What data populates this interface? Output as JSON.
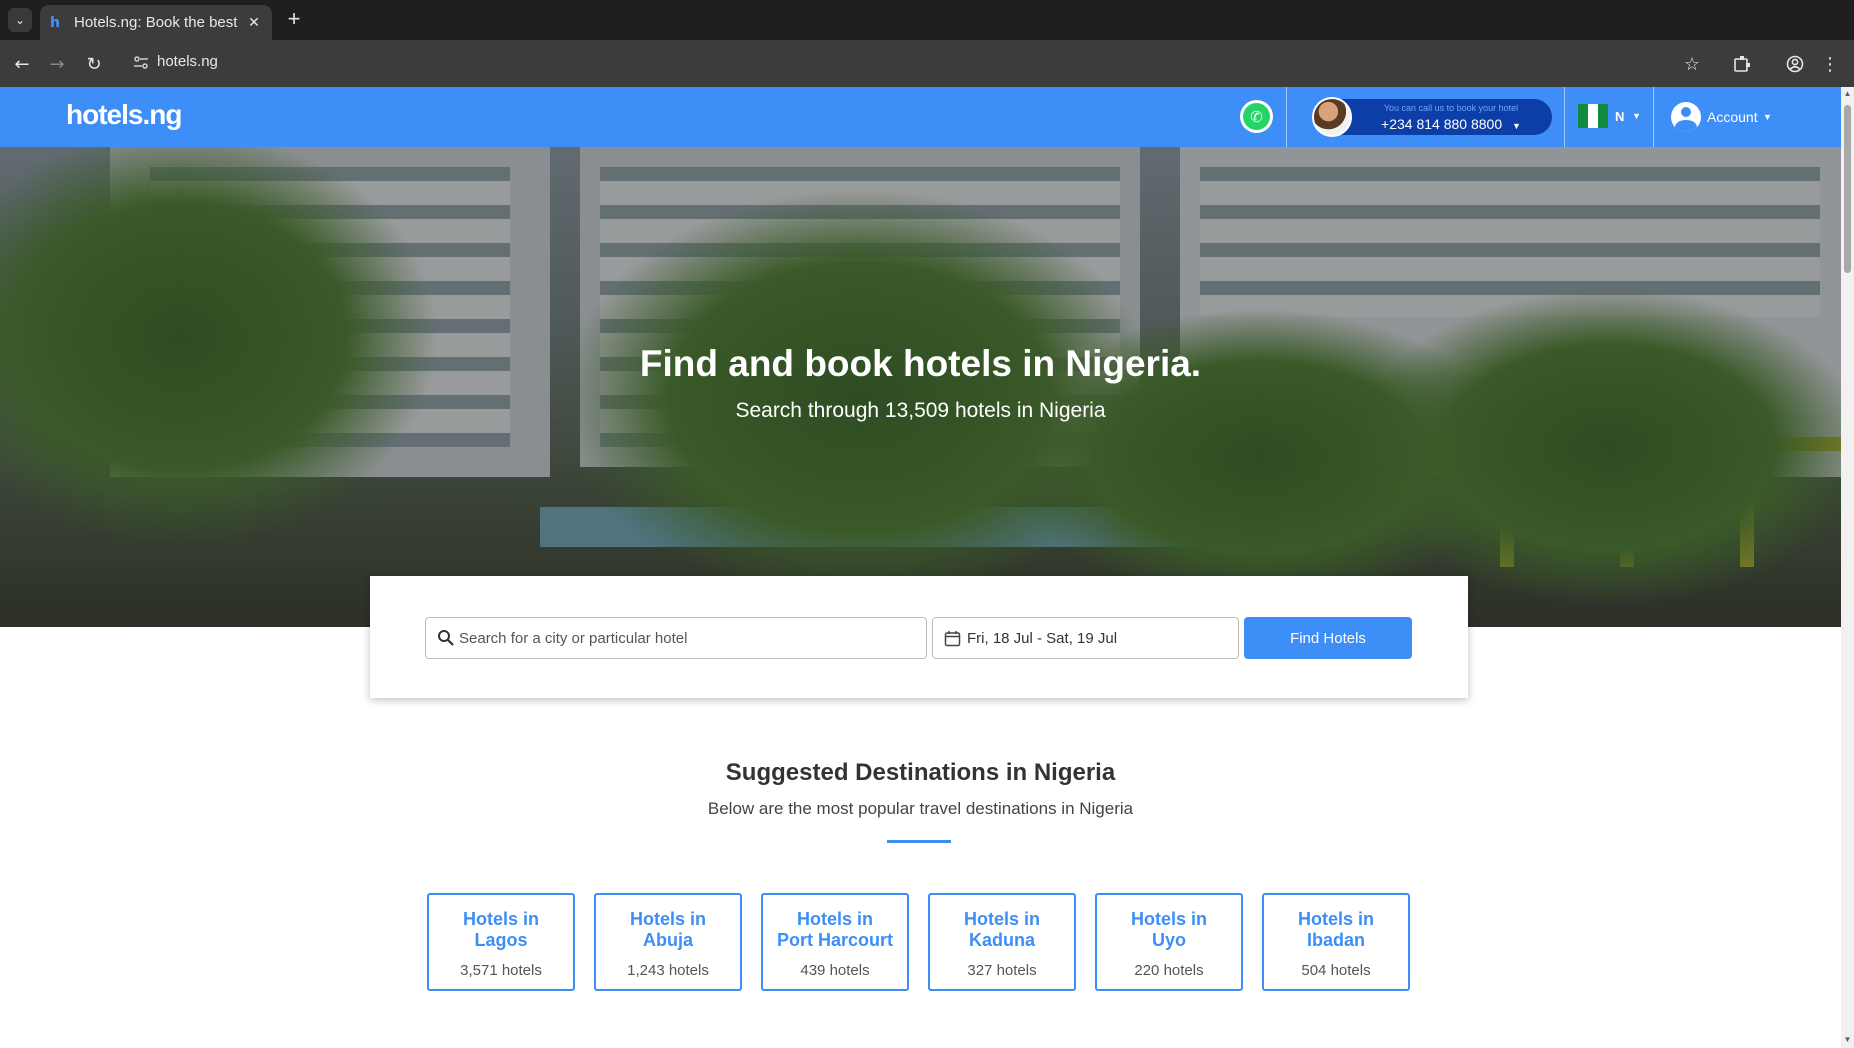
{
  "browser": {
    "tab_title": "Hotels.ng: Book the best",
    "tab_favicon": "h",
    "url": "hotels.ng",
    "icons": [
      "tab-list-icon",
      "close-icon",
      "new-tab-icon",
      "back-icon",
      "forward-icon",
      "reload-icon",
      "site-info-icon",
      "star-icon",
      "extensions-icon",
      "profile-icon",
      "menu-icon"
    ]
  },
  "header": {
    "logo": "hotels.ng",
    "call_caption": "You can call us to book your hotel",
    "call_number": "+234 814 880 8800",
    "language": "N",
    "account_label": "Account",
    "accent_color": "#3d8ef6"
  },
  "hero": {
    "title": "Find and book hotels in Nigeria.",
    "subtitle": "Search through 13,509 hotels in Nigeria"
  },
  "search": {
    "placeholder": "Search for a city or particular hotel",
    "dates": "Fri, 18 Jul - Sat, 19 Jul",
    "button": "Find Hotels"
  },
  "destinations": {
    "title": "Suggested Destinations in Nigeria",
    "subtitle": "Below are the most popular travel destinations in Nigeria",
    "cards": [
      {
        "line1": "Hotels in",
        "line2": "Lagos",
        "count": "3,571 hotels"
      },
      {
        "line1": "Hotels in",
        "line2": "Abuja",
        "count": "1,243 hotels"
      },
      {
        "line1": "Hotels in",
        "line2": "Port Harcourt",
        "count": "439 hotels"
      },
      {
        "line1": "Hotels in",
        "line2": "Kaduna",
        "count": "327 hotels"
      },
      {
        "line1": "Hotels in",
        "line2": "Uyo",
        "count": "220 hotels"
      },
      {
        "line1": "Hotels in",
        "line2": "Ibadan",
        "count": "504 hotels"
      }
    ]
  }
}
